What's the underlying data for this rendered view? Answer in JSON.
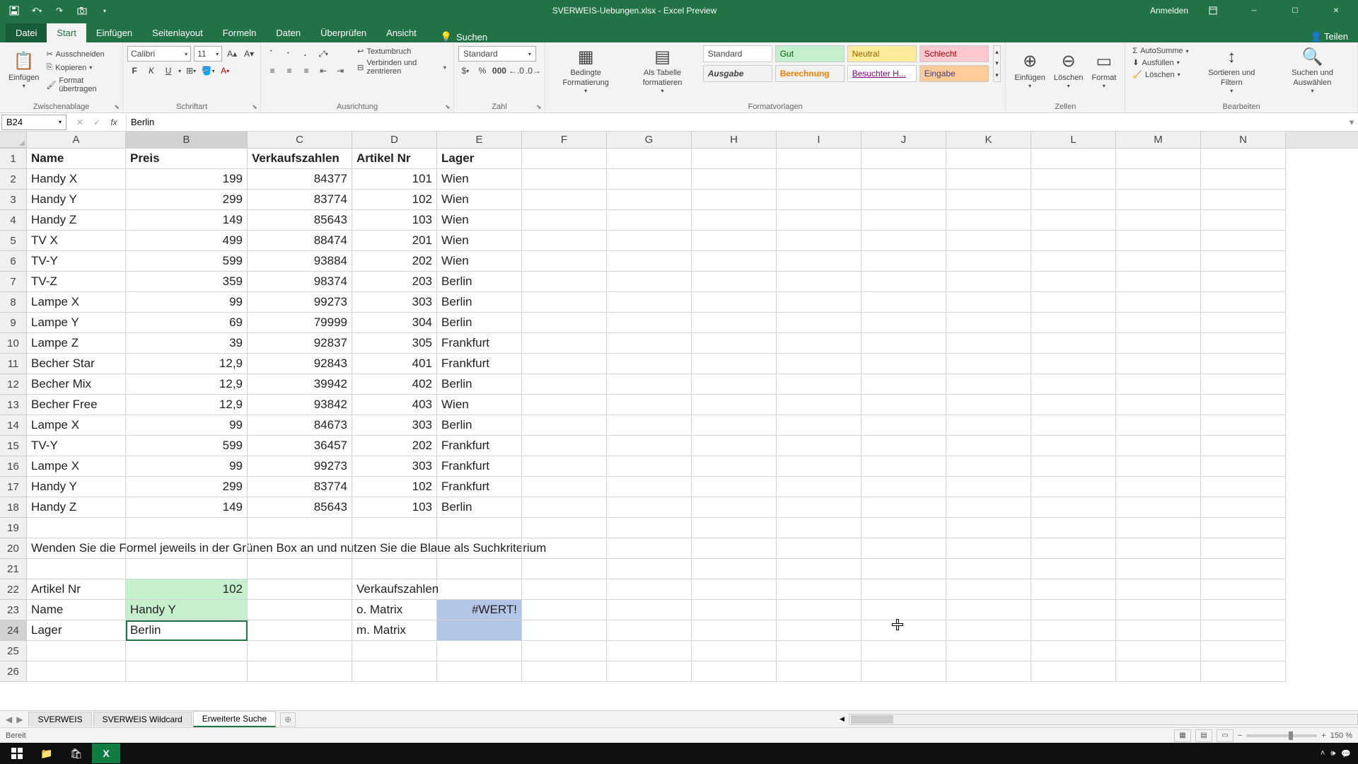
{
  "titlebar": {
    "title": "SVERWEIS-Uebungen.xlsx - Excel Preview",
    "login": "Anmelden"
  },
  "ribbon_tabs": {
    "file": "Datei",
    "home": "Start",
    "insert": "Einfügen",
    "pagelayout": "Seitenlayout",
    "formulas": "Formeln",
    "data": "Daten",
    "review": "Überprüfen",
    "view": "Ansicht",
    "tellme": "Suchen",
    "share": "Teilen"
  },
  "ribbon": {
    "paste": "Einfügen",
    "cut": "Ausschneiden",
    "copy": "Kopieren",
    "format_painter": "Format übertragen",
    "clipboard_label": "Zwischenablage",
    "font_name": "Calibri",
    "font_size": "11",
    "font_label": "Schriftart",
    "wrap": "Textumbruch",
    "merge": "Verbinden und zentrieren",
    "align_label": "Ausrichtung",
    "number_format": "Standard",
    "number_label": "Zahl",
    "cond_format": "Bedingte Formatierung",
    "as_table": "Als Tabelle formatieren",
    "style_standard": "Standard",
    "style_gut": "Gut",
    "style_neutral": "Neutral",
    "style_schlecht": "Schlecht",
    "style_ausgabe": "Ausgabe",
    "style_berechnung": "Berechnung",
    "style_besucht": "Besuchter H...",
    "style_eingabe": "Eingabe",
    "styles_label": "Formatvorlagen",
    "insert_cells": "Einfügen",
    "delete_cells": "Löschen",
    "format_cells": "Format",
    "cells_label": "Zellen",
    "autosum": "AutoSumme",
    "fill": "Ausfüllen",
    "clear": "Löschen",
    "sort_filter": "Sortieren und Filtern",
    "find_select": "Suchen und Auswählen",
    "editing_label": "Bearbeiten"
  },
  "formula_bar": {
    "cell_ref": "B24",
    "formula": "Berlin"
  },
  "columns": [
    "A",
    "B",
    "C",
    "D",
    "E",
    "F",
    "G",
    "H",
    "I",
    "J",
    "K",
    "L",
    "M",
    "N"
  ],
  "selected_col": "B",
  "selected_row": "24",
  "headers": {
    "name": "Name",
    "preis": "Preis",
    "verkaufszahlen": "Verkaufszahlen",
    "artikelnr": "Artikel Nr",
    "lager": "Lager"
  },
  "rows": [
    {
      "name": "Handy X",
      "preis": "199",
      "verkauf": "84377",
      "art": "101",
      "lager": "Wien"
    },
    {
      "name": "Handy Y",
      "preis": "299",
      "verkauf": "83774",
      "art": "102",
      "lager": "Wien"
    },
    {
      "name": "Handy Z",
      "preis": "149",
      "verkauf": "85643",
      "art": "103",
      "lager": "Wien"
    },
    {
      "name": "TV X",
      "preis": "499",
      "verkauf": "88474",
      "art": "201",
      "lager": "Wien"
    },
    {
      "name": "TV-Y",
      "preis": "599",
      "verkauf": "93884",
      "art": "202",
      "lager": "Wien"
    },
    {
      "name": "TV-Z",
      "preis": "359",
      "verkauf": "98374",
      "art": "203",
      "lager": "Berlin"
    },
    {
      "name": "Lampe X",
      "preis": "99",
      "verkauf": "99273",
      "art": "303",
      "lager": "Berlin"
    },
    {
      "name": "Lampe Y",
      "preis": "69",
      "verkauf": "79999",
      "art": "304",
      "lager": "Berlin"
    },
    {
      "name": "Lampe Z",
      "preis": "39",
      "verkauf": "92837",
      "art": "305",
      "lager": "Frankfurt"
    },
    {
      "name": "Becher Star",
      "preis": "12,9",
      "verkauf": "92843",
      "art": "401",
      "lager": "Frankfurt"
    },
    {
      "name": "Becher Mix",
      "preis": "12,9",
      "verkauf": "39942",
      "art": "402",
      "lager": "Berlin"
    },
    {
      "name": "Becher Free",
      "preis": "12,9",
      "verkauf": "93842",
      "art": "403",
      "lager": "Wien"
    },
    {
      "name": "Lampe X",
      "preis": "99",
      "verkauf": "84673",
      "art": "303",
      "lager": "Berlin"
    },
    {
      "name": "TV-Y",
      "preis": "599",
      "verkauf": "36457",
      "art": "202",
      "lager": "Frankfurt"
    },
    {
      "name": "Lampe X",
      "preis": "99",
      "verkauf": "99273",
      "art": "303",
      "lager": "Frankfurt"
    },
    {
      "name": "Handy Y",
      "preis": "299",
      "verkauf": "83774",
      "art": "102",
      "lager": "Frankfurt"
    },
    {
      "name": "Handy Z",
      "preis": "149",
      "verkauf": "85643",
      "art": "103",
      "lager": "Berlin"
    }
  ],
  "instruction": "Wenden Sie die Formel jeweils in der Grünen Box an und nutzen Sie die Blaue als Suchkriterium",
  "lookup": {
    "artikelnr_label": "Artikel Nr",
    "artikelnr_val": "102",
    "name_label": "Name",
    "name_val": "Handy Y",
    "lager_label": "Lager",
    "lager_val": "Berlin",
    "verkauf_label": "Verkaufszahlen",
    "o_matrix": "o. Matrix",
    "m_matrix": "m. Matrix",
    "error": "#WERT!"
  },
  "sheets": {
    "s1": "SVERWEIS",
    "s2": "SVERWEIS Wildcard",
    "s3": "Erweiterte Suche"
  },
  "status": {
    "ready": "Bereit",
    "zoom": "150 %"
  }
}
